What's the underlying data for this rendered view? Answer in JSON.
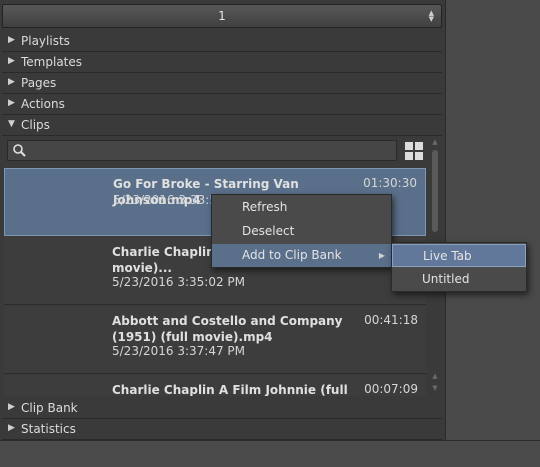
{
  "selector": {
    "value": "1"
  },
  "sections": {
    "playlists": "Playlists",
    "templates": "Templates",
    "pages": "Pages",
    "actions": "Actions",
    "clips": "Clips",
    "clip_bank": "Clip Bank",
    "statistics": "Statistics"
  },
  "search": {
    "placeholder": ""
  },
  "clips": [
    {
      "name": "Go For Broke - Starring Van Johnson.mp4",
      "date": "5/23/2016 3:33:51 PM",
      "duration": "01:30:30"
    },
    {
      "name": "Charlie Chaplin Th... (1914) (full movie)...",
      "date": "5/23/2016 3:35:02 PM",
      "duration": ""
    },
    {
      "name": "Abbott and Costello and Company (1951) (full movie).mp4",
      "date": "5/23/2016 3:37:47 PM",
      "duration": "00:41:18"
    },
    {
      "name": "Charlie Chaplin A Film Johnnie (full",
      "date": "",
      "duration": "00:07:09"
    }
  ],
  "context_menu": {
    "items": [
      "Refresh",
      "Deselect",
      "Add to Clip Bank"
    ]
  },
  "submenu": {
    "items": [
      "Live Tab",
      "Untitled"
    ]
  }
}
